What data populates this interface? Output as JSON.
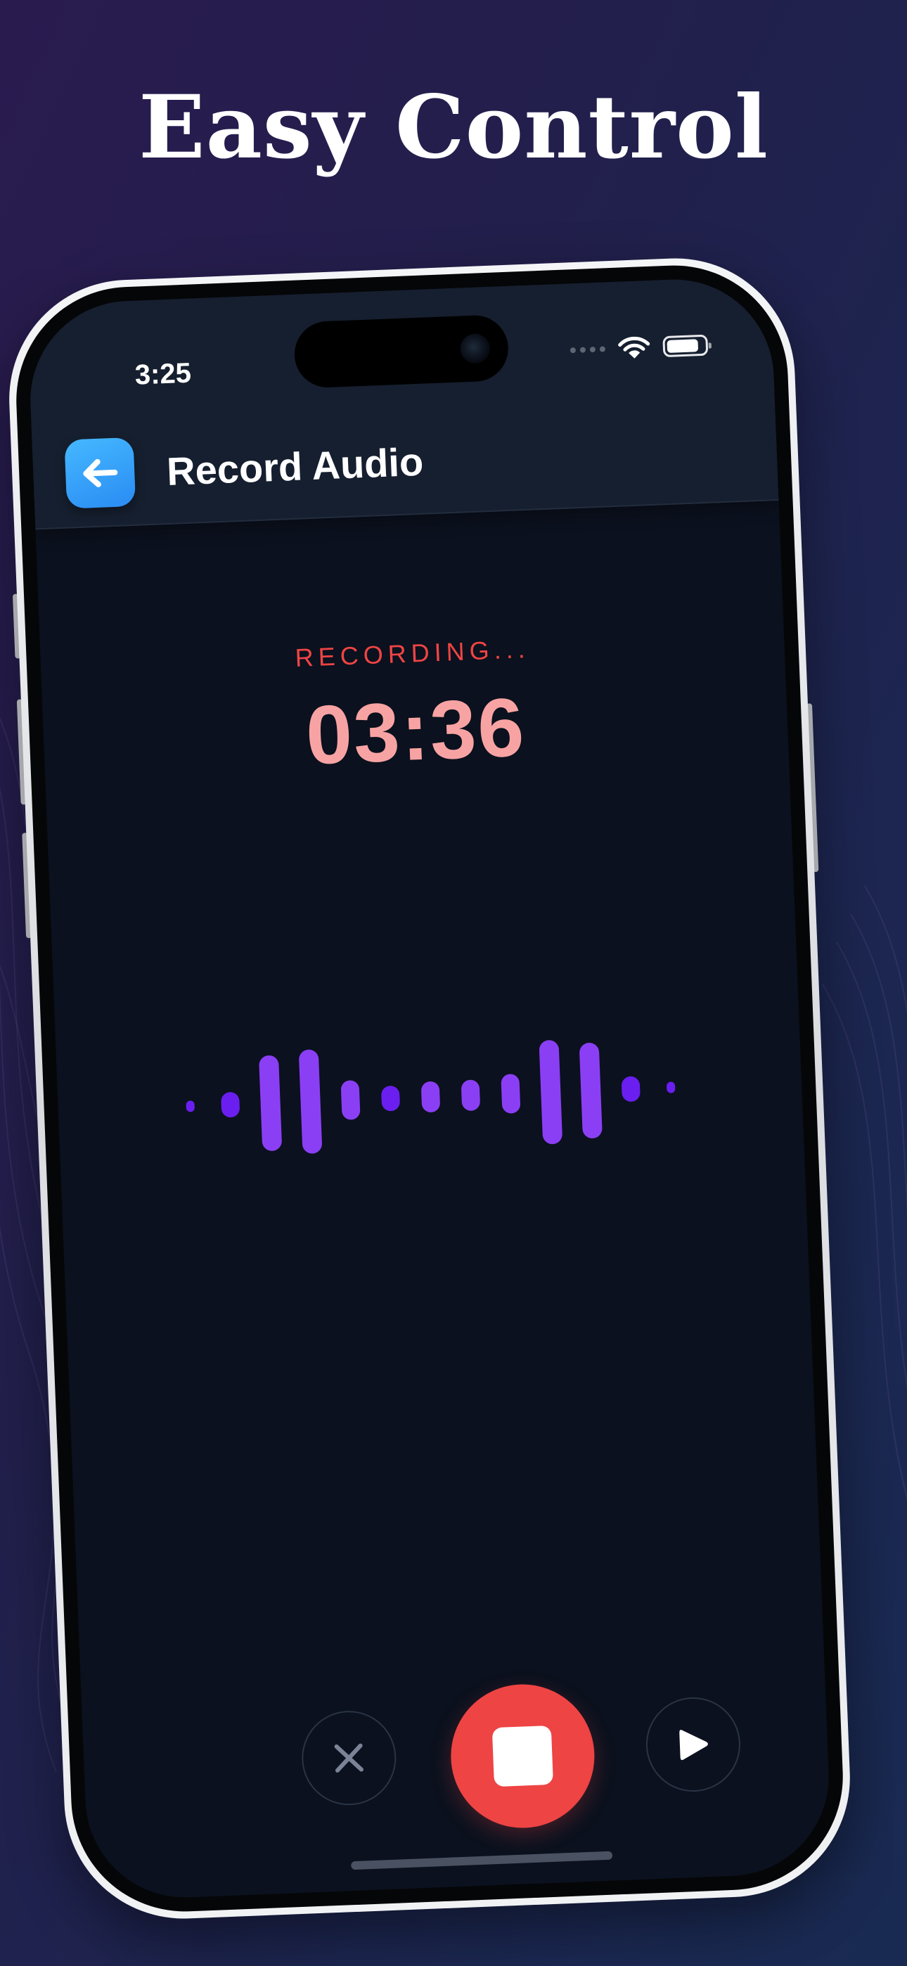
{
  "headline": "Easy Control",
  "status_bar": {
    "time": "3:25",
    "battery_level": 0.85
  },
  "header": {
    "title": "Record Audio",
    "back_icon": "arrow-left-icon"
  },
  "recording": {
    "status": "RECORDING...",
    "timer": "03:36",
    "waveform_levels": [
      0.07,
      0.18,
      0.68,
      0.74,
      0.28,
      0.18,
      0.22,
      0.22,
      0.28,
      0.74,
      0.68,
      0.18,
      0.07
    ]
  },
  "controls": {
    "cancel_icon": "close-icon",
    "stop_icon": "stop-icon",
    "play_icon": "play-icon"
  },
  "colors": {
    "accent_blue": "#2a8cf3",
    "record_red": "#ee4444",
    "status_red": "#ef4444",
    "timer_pink": "#f8a3a3",
    "wave_purple": "#8b3ff5",
    "screen_bg": "#0b111e",
    "header_bg": "#161f2f"
  }
}
